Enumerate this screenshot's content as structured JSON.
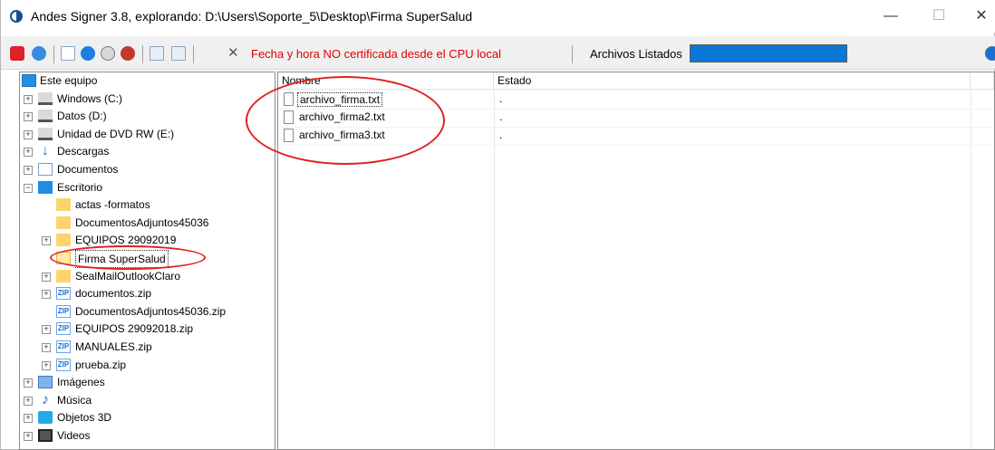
{
  "window": {
    "title": "Andes Signer 3.8, explorando: D:\\Users\\Soporte_5\\Desktop\\Firma SuperSalud",
    "minimize": "—",
    "maximize": "☐",
    "close": "✕"
  },
  "toolbar": {
    "warning": "Fecha y hora NO certificada desde el CPU local",
    "files_label": "Archivos Listados",
    "accent_color": "#0a78d7",
    "warning_color": "#e00000"
  },
  "tree": {
    "root": "Este equipo",
    "items": [
      {
        "label": "Windows (C:)",
        "icon": "drive-icon"
      },
      {
        "label": "Datos (D:)",
        "icon": "drive-icon"
      },
      {
        "label": "Unidad de DVD RW (E:)",
        "icon": "dvd-icon"
      },
      {
        "label": "Descargas",
        "icon": "download-icon"
      },
      {
        "label": "Documentos",
        "icon": "document-icon"
      },
      {
        "label": "Escritorio",
        "icon": "desktop-icon"
      },
      {
        "label": "actas -formatos",
        "icon": "folder-icon"
      },
      {
        "label": "DocumentosAdjuntos45036",
        "icon": "folder-icon"
      },
      {
        "label": "EQUIPOS 29092019",
        "icon": "folder-icon"
      },
      {
        "label": "Firma SuperSalud",
        "icon": "folder-open-icon"
      },
      {
        "label": "SealMailOutlookClaro",
        "icon": "folder-icon"
      },
      {
        "label": "documentos.zip",
        "icon": "zip-icon"
      },
      {
        "label": "DocumentosAdjuntos45036.zip",
        "icon": "zip-icon"
      },
      {
        "label": "EQUIPOS 29092018.zip",
        "icon": "zip-icon"
      },
      {
        "label": "MANUALES.zip",
        "icon": "zip-icon"
      },
      {
        "label": "prueba.zip",
        "icon": "zip-icon"
      },
      {
        "label": "Imágenes",
        "icon": "pictures-icon"
      },
      {
        "label": "Música",
        "icon": "music-icon"
      },
      {
        "label": "Objetos 3D",
        "icon": "objects3d-icon"
      },
      {
        "label": "Videos",
        "icon": "video-icon"
      }
    ],
    "zip_badge": "ZIP"
  },
  "list": {
    "columns": [
      "Nombre",
      "Estado"
    ],
    "files": [
      {
        "name": "archivo_firma.txt",
        "state": "."
      },
      {
        "name": "archivo_firma2.txt",
        "state": "."
      },
      {
        "name": "archivo_firma3.txt",
        "state": "."
      }
    ]
  }
}
